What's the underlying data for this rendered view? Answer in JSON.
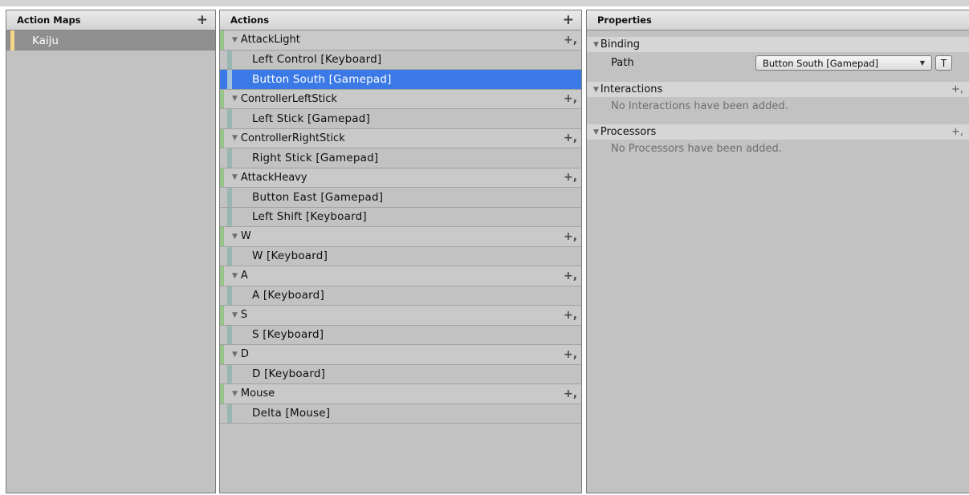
{
  "action_maps": {
    "title": "Action Maps",
    "add_icon": "+",
    "items": [
      {
        "label": "Kaiju"
      }
    ],
    "colors": {
      "selected_bg": "#8f8f8f",
      "marker": "#f6d68b"
    }
  },
  "actions": {
    "title": "Actions",
    "add_icon": "+",
    "rows": [
      {
        "kind": "action",
        "label": "AttackLight"
      },
      {
        "kind": "binding",
        "label": "Left Control [Keyboard]"
      },
      {
        "kind": "binding",
        "label": "Button South [Gamepad]",
        "selected": true
      },
      {
        "kind": "action",
        "label": "ControllerLeftStick"
      },
      {
        "kind": "binding",
        "label": "Left Stick [Gamepad]"
      },
      {
        "kind": "action",
        "label": "ControllerRightStick"
      },
      {
        "kind": "binding",
        "label": "Right Stick [Gamepad]"
      },
      {
        "kind": "action",
        "label": "AttackHeavy"
      },
      {
        "kind": "binding",
        "label": "Button East [Gamepad]"
      },
      {
        "kind": "binding",
        "label": "Left Shift [Keyboard]"
      },
      {
        "kind": "action",
        "label": "W"
      },
      {
        "kind": "binding",
        "label": "W [Keyboard]"
      },
      {
        "kind": "action",
        "label": "A"
      },
      {
        "kind": "binding",
        "label": "A [Keyboard]"
      },
      {
        "kind": "action",
        "label": "S"
      },
      {
        "kind": "binding",
        "label": "S [Keyboard]"
      },
      {
        "kind": "action",
        "label": "D"
      },
      {
        "kind": "binding",
        "label": "D [Keyboard]"
      },
      {
        "kind": "action",
        "label": "Mouse"
      },
      {
        "kind": "binding",
        "label": "Delta [Mouse]"
      }
    ],
    "colors": {
      "action_bar": "#98c38a",
      "binding_bar": "#99b6b2",
      "selected_bg": "#3b7ae6"
    }
  },
  "properties": {
    "title": "Properties",
    "binding": {
      "section_label": "Binding",
      "path_label": "Path",
      "path_value": "Button South [Gamepad]",
      "t_button_label": "T"
    },
    "interactions": {
      "section_label": "Interactions",
      "empty_text": "No Interactions have been added."
    },
    "processors": {
      "section_label": "Processors",
      "empty_text": "No Processors have been added."
    }
  },
  "icons": {
    "collapse": "triangle-down-icon",
    "add": "plus-icon",
    "dropdown": "dropdown-arrow-icon"
  }
}
